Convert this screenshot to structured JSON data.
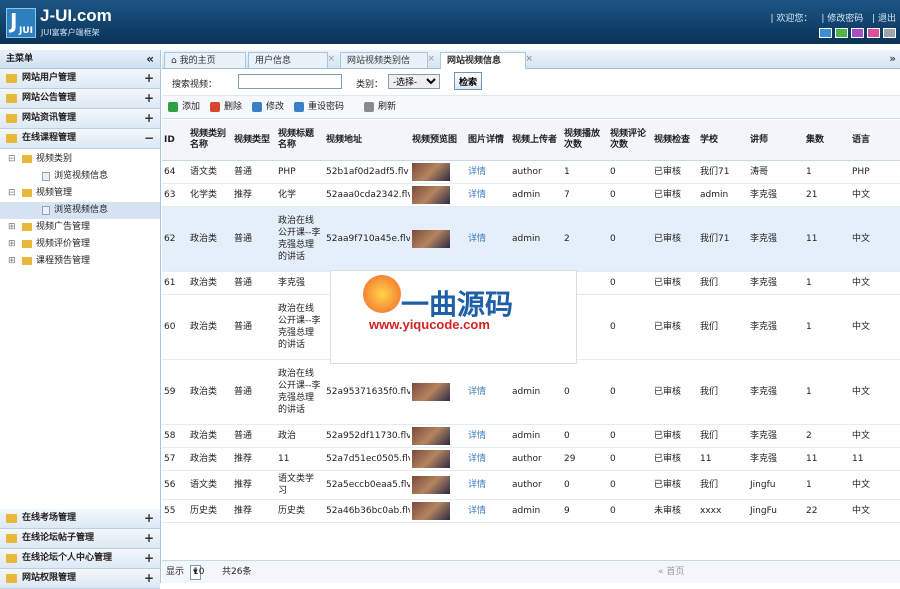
{
  "header": {
    "logo_icon_text": "JUI",
    "logo_title": "J-UI.com",
    "logo_subtitle": "JUI富客户端框架",
    "links": [
      "| 欢迎您：",
      "| 修改密码",
      "| 退出"
    ],
    "theme_colors": [
      "#3b8fd6",
      "#52b34a",
      "#a64fc8",
      "#d94f9a",
      "#9aa5b0"
    ]
  },
  "sidebar": {
    "title": "主菜单",
    "collapse_icon": "«",
    "groups_top": [
      {
        "label": "网站用户管理",
        "toggle": "+"
      },
      {
        "label": "网站公告管理",
        "toggle": "+"
      },
      {
        "label": "网站资讯管理",
        "toggle": "+"
      },
      {
        "label": "在线课程管理",
        "toggle": "−"
      }
    ],
    "tree": [
      {
        "label": "视频类别",
        "level": 0,
        "toggle": "⊟"
      },
      {
        "label": "浏览视频信息",
        "level": 1
      },
      {
        "label": "视频管理",
        "level": 0,
        "toggle": "⊟"
      },
      {
        "label": "浏览视频信息",
        "level": 1,
        "selected": true
      },
      {
        "label": "视频广告管理",
        "level": 0,
        "toggle": "⊞"
      },
      {
        "label": "视频评价管理",
        "level": 0,
        "toggle": "⊞"
      },
      {
        "label": "课程预告管理",
        "level": 0,
        "toggle": "⊞"
      }
    ],
    "groups_bottom": [
      {
        "label": "在线考场管理",
        "toggle": "+"
      },
      {
        "label": "在线论坛帖子管理",
        "toggle": "+"
      },
      {
        "label": "在线论坛个人中心管理",
        "toggle": "+"
      },
      {
        "label": "网站权限管理",
        "toggle": "+"
      }
    ]
  },
  "tabs": [
    "我的主页",
    "用户信息",
    "网站视频类别信",
    "网站视频信息"
  ],
  "tab_close": "×",
  "tab_more": "»",
  "search": {
    "video_label": "搜索视频：",
    "video_value": "",
    "category_label": "类别：",
    "category_selected": "-选择-",
    "search_button": "检索"
  },
  "toolbar": {
    "add": "添加",
    "delete": "删除",
    "edit": "修改",
    "reset_password": "重设密码",
    "refresh": "刷新"
  },
  "table": {
    "columns": [
      "ID",
      "视频类别名称",
      "视频类型",
      "视频标题名称",
      "视频地址",
      "视频预览图",
      "图片详情",
      "视频上传者",
      "视频播放次数",
      "视频评论次数",
      "视频检查",
      "学校",
      "讲师",
      "集数",
      "语言"
    ],
    "rows": [
      {
        "id": "64",
        "cat": "语文类",
        "type": "普通",
        "title": "PHP",
        "addr": "52b1af0d2adf5.flv",
        "detail": "详情",
        "uploader": "author",
        "plays": "1",
        "comments": "0",
        "check": "已审核",
        "school": "我们71",
        "teacher": "涛哥",
        "eps": "1",
        "lang": "PHP"
      },
      {
        "id": "63",
        "cat": "化学类",
        "type": "推荐",
        "title": "化学",
        "addr": "52aaa0cda2342.flv",
        "detail": "详情",
        "uploader": "admin",
        "plays": "7",
        "comments": "0",
        "check": "已审核",
        "school": "admin",
        "teacher": "李克强",
        "eps": "21",
        "lang": "中文"
      },
      {
        "id": "62",
        "cat": "政治类",
        "type": "普通",
        "title": "政治在线公开课--李克强总理的讲话",
        "addr": "52aa9f710a45e.flv",
        "detail": "详情",
        "uploader": "admin",
        "plays": "2",
        "comments": "0",
        "check": "已审核",
        "school": "我们71",
        "teacher": "李克强",
        "eps": "11",
        "lang": "中文"
      },
      {
        "id": "61",
        "cat": "政治类",
        "type": "普通",
        "title": "李克强",
        "addr": "",
        "detail": "",
        "uploader": "",
        "plays": "",
        "comments": "0",
        "check": "已审核",
        "school": "我们",
        "teacher": "李克强",
        "eps": "1",
        "lang": "中文"
      },
      {
        "id": "60",
        "cat": "政治类",
        "type": "普通",
        "title": "政治在线公开课--李克强总理的讲话",
        "addr": "",
        "detail": "",
        "uploader": "",
        "plays": "",
        "comments": "0",
        "check": "已审核",
        "school": "我们",
        "teacher": "李克强",
        "eps": "1",
        "lang": "中文"
      },
      {
        "id": "59",
        "cat": "政治类",
        "type": "普通",
        "title": "政治在线公开课--李克强总理的讲话",
        "addr": "52a95371635f0.flv",
        "detail": "详情",
        "uploader": "admin",
        "plays": "0",
        "comments": "0",
        "check": "已审核",
        "school": "我们",
        "teacher": "李克强",
        "eps": "1",
        "lang": "中文"
      },
      {
        "id": "58",
        "cat": "政治类",
        "type": "普通",
        "title": "政治",
        "addr": "52a952df11730.flv",
        "detail": "详情",
        "uploader": "admin",
        "plays": "0",
        "comments": "0",
        "check": "已审核",
        "school": "我们",
        "teacher": "李克强",
        "eps": "2",
        "lang": "中文"
      },
      {
        "id": "57",
        "cat": "政治类",
        "type": "推荐",
        "title": "11",
        "addr": "52a7d51ec0505.flv",
        "detail": "详情",
        "uploader": "author",
        "plays": "29",
        "comments": "0",
        "check": "已审核",
        "school": "11",
        "teacher": "李克强",
        "eps": "11",
        "lang": "11"
      },
      {
        "id": "56",
        "cat": "语文类",
        "type": "推荐",
        "title": "语文类学习",
        "addr": "52a5eccb0eaa5.flv",
        "detail": "详情",
        "uploader": "author",
        "plays": "0",
        "comments": "0",
        "check": "已审核",
        "school": "我们",
        "teacher": "Jingfu",
        "eps": "1",
        "lang": "中文"
      },
      {
        "id": "55",
        "cat": "历史类",
        "type": "推荐",
        "title": "历史类",
        "addr": "52a46b36bc0ab.flv",
        "detail": "详情",
        "uploader": "admin",
        "plays": "9",
        "comments": "0",
        "check": "未审核",
        "school": "xxxx",
        "teacher": "JingFu",
        "eps": "22",
        "lang": "中文"
      }
    ]
  },
  "pager": {
    "show_label": "显示",
    "page_size": "10",
    "total": "共26条",
    "first_page": "« 首页"
  },
  "watermark": {
    "brand": "一曲源码",
    "url": "www.yiqucode.com"
  }
}
